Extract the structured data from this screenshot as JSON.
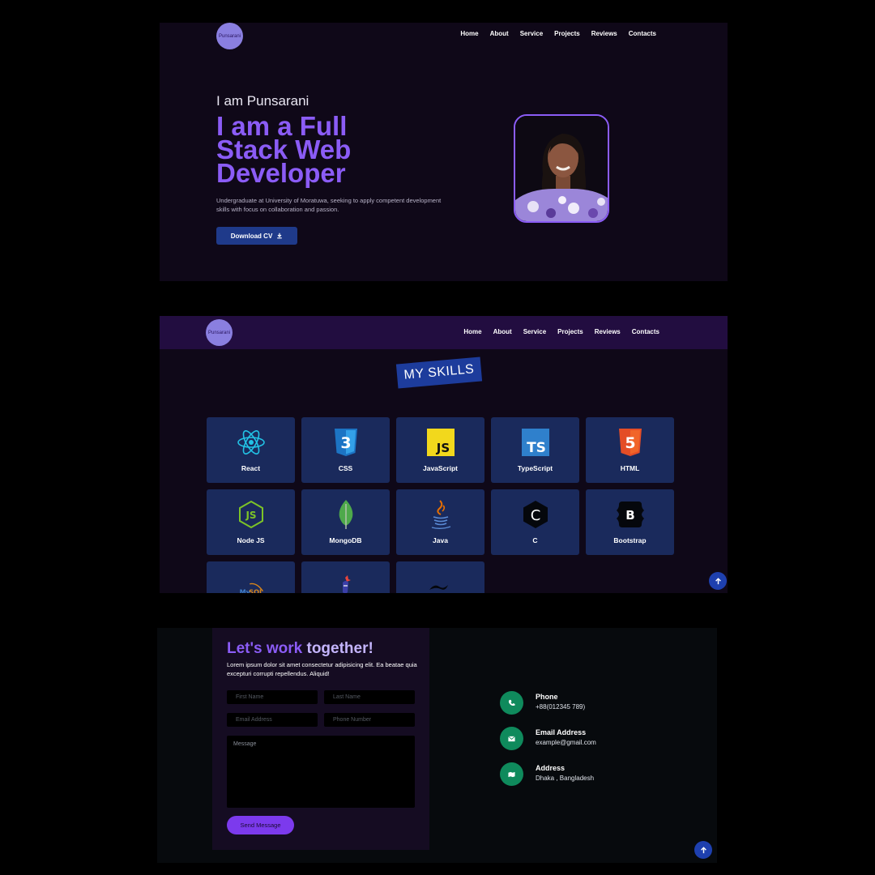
{
  "nav": {
    "logo_text": "Punsarani",
    "items": [
      "Home",
      "About",
      "Service",
      "Projects",
      "Reviews",
      "Contacts"
    ]
  },
  "hero": {
    "intro": "I am Punsarani",
    "title_line1": "I am a Full",
    "title_line2": "Stack Web",
    "title_line3": "Developer",
    "description": "Undergraduate at University of Moratuwa, seeking to apply competent development skills with focus on collaboration and passion.",
    "cta_label": "Download CV",
    "cta_icon": "download-icon"
  },
  "skills": {
    "heading": "MY SKILLS",
    "items": [
      {
        "label": "React",
        "icon": "react-icon"
      },
      {
        "label": "CSS",
        "icon": "css3-icon"
      },
      {
        "label": "JavaScript",
        "icon": "javascript-icon"
      },
      {
        "label": "TypeScript",
        "icon": "typescript-icon"
      },
      {
        "label": "HTML",
        "icon": "html5-icon"
      },
      {
        "label": "Node JS",
        "icon": "nodejs-icon"
      },
      {
        "label": "MongoDB",
        "icon": "mongodb-icon"
      },
      {
        "label": "Java",
        "icon": "java-icon"
      },
      {
        "label": "C",
        "icon": "c-icon"
      },
      {
        "label": "Bootstrap",
        "icon": "bootstrap-icon"
      },
      {
        "label": "",
        "icon": "mysql-icon"
      },
      {
        "label": "",
        "icon": "postman-icon"
      },
      {
        "label": "",
        "icon": "tailwind-icon"
      }
    ]
  },
  "contact": {
    "title_a": "Let's work",
    "title_b": " together!",
    "subtitle": "Lorem ipsum dolor sit amet consectetur adipisicing elit. Ea beatae quia excepturi corrupti repellendus. Aliquid!",
    "placeholders": {
      "first_name": "First Name",
      "last_name": "Last Name",
      "email": "Email Address",
      "phone": "Phone Number",
      "message": "Message"
    },
    "send_label": "Send Message",
    "info": [
      {
        "title": "Phone",
        "value": "+88(012345 789)",
        "icon": "phone-icon"
      },
      {
        "title": "Email Address",
        "value": "example@gmail.com",
        "icon": "mail-icon"
      },
      {
        "title": "Address",
        "value": "Dhaka , Bangladesh",
        "icon": "map-icon"
      }
    ]
  },
  "colors": {
    "accent": "#8b5cf6",
    "button_blue": "#1f3a8a",
    "card_bg": "#1a2a5c",
    "icon_green": "#0f8a5c"
  }
}
